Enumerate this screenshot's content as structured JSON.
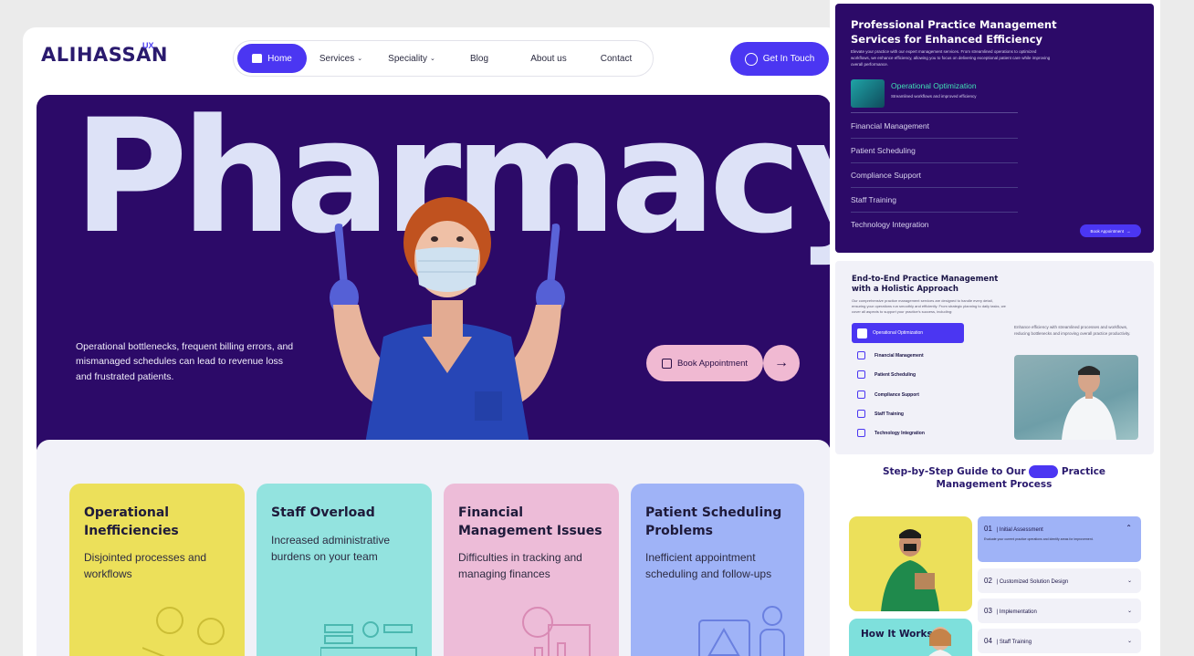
{
  "logo": {
    "name": "ALIHASSAN",
    "superscript": "UX"
  },
  "nav": {
    "home": "Home",
    "services": "Services",
    "speciality": "Speciality",
    "blog": "Blog",
    "about": "About us",
    "contact": "Contact",
    "caret": "⌄"
  },
  "cta_top": "Get In Touch",
  "hero": {
    "title": "Pharmacy",
    "text": "Operational bottlenecks, frequent billing errors, and mismanaged schedules can lead to revenue loss and frustrated patients.",
    "book_label": "Book Appointment",
    "arrow": "→"
  },
  "cards": [
    {
      "title": "Operational Inefficiencies",
      "body": "Disjointed processes and workflows"
    },
    {
      "title": "Staff Overload",
      "body": "Increased administrative burdens on your team"
    },
    {
      "title": "Financial Management Issues",
      "body": "Difficulties in tracking and managing finances"
    },
    {
      "title": "Patient Scheduling Problems",
      "body": "Inefficient appointment scheduling and follow-ups"
    }
  ],
  "panel1": {
    "title": "Professional Practice Management Services for Enhanced Efficiency",
    "desc": "Elevate your practice with our expert management services. From streamlined operations to optimized workflows, we enhance efficiency, allowing you to focus on delivering exceptional patient care while improving overall performance.",
    "active_label": "Operational Optimization",
    "active_sub": "Streamlined workflows and improved efficiency",
    "items": [
      "Financial Management",
      "Patient Scheduling",
      "Compliance Support",
      "Staff Training",
      "Technology Integration"
    ],
    "button": "Book Appointment"
  },
  "panel2": {
    "title": "End-to-End Practice Management with a Holistic Approach",
    "desc": "Our comprehensive practice management services are designed to handle every detail, ensuring your operations run smoothly and efficiently. From strategic planning to daily tasks, we cover all aspects to support your practice's success, including:",
    "active": "Operational Optimization",
    "items": [
      "Financial Management",
      "Patient Scheduling",
      "Compliance Support",
      "Staff Training",
      "Technology Integration"
    ],
    "side_text": "Enhance efficiency with streamlined processes and workflows, reducing bottlenecks and improving overall practice productivity."
  },
  "steps": {
    "title_part1": "Step-by-Step Guide to Our",
    "title_part2": "Practice Management Process",
    "how": "How It Works?",
    "open": {
      "num": "01",
      "label": "Initial Assessment",
      "sub": "Evaluate your current practice operations and identify areas for improvement."
    },
    "items": [
      {
        "num": "02",
        "label": "Customized Solution Design"
      },
      {
        "num": "03",
        "label": "Implementation"
      },
      {
        "num": "04",
        "label": "Staff Training"
      }
    ],
    "chev_up": "⌃",
    "chev_down": "⌄"
  },
  "colors": {
    "brand": "#4b36f2",
    "hero_bg": "#2c0a68",
    "yellow": "#ece05a",
    "cyan": "#93e3df",
    "pink": "#edbcd8",
    "blue": "#9fb3f7"
  }
}
